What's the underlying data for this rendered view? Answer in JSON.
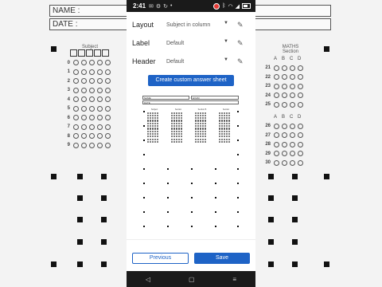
{
  "background": {
    "name_label": "NAME :",
    "date_label": "DATE :",
    "left_column_title": "Subject",
    "right_column_title": "MATHS",
    "right_column_subtitle": "Section",
    "right_header_letters": [
      "A",
      "B",
      "C",
      "D"
    ],
    "left_rows": [
      "0",
      "1",
      "2",
      "3",
      "4",
      "5",
      "6",
      "7",
      "8",
      "9"
    ],
    "right_rows_top": [
      "21",
      "22",
      "23",
      "24",
      "25"
    ],
    "right_rows_bottom": [
      "26",
      "27",
      "28",
      "29",
      "30"
    ]
  },
  "status_bar": {
    "time": "2:41",
    "icons": [
      "mail-icon",
      "gear-icon",
      "sync-icon",
      "dot-icon"
    ],
    "right_icons": [
      "record-icon",
      "bluetooth-icon",
      "wifi-icon",
      "signal-icon",
      "battery-icon"
    ]
  },
  "settings": {
    "layout": {
      "label": "Layout",
      "value": "Subject in column"
    },
    "label_row": {
      "label": "Label",
      "value": "Default"
    },
    "header": {
      "label": "Header",
      "value": "Default"
    }
  },
  "create_button": "Create custom answer sheet",
  "preview": {
    "name_label": "NAME",
    "exam_label": "EXAM",
    "date_label": "DATE",
    "column_titles": [
      "Subject",
      "Section",
      "Section B",
      "Section"
    ]
  },
  "footer": {
    "previous": "Previous",
    "save": "Save"
  },
  "nav_bar": {
    "back": "◁",
    "home": "▢",
    "recents": "≡"
  },
  "colors": {
    "accent": "#1e63c6",
    "status_bar": "#1a1a1a",
    "record": "#e53935"
  }
}
